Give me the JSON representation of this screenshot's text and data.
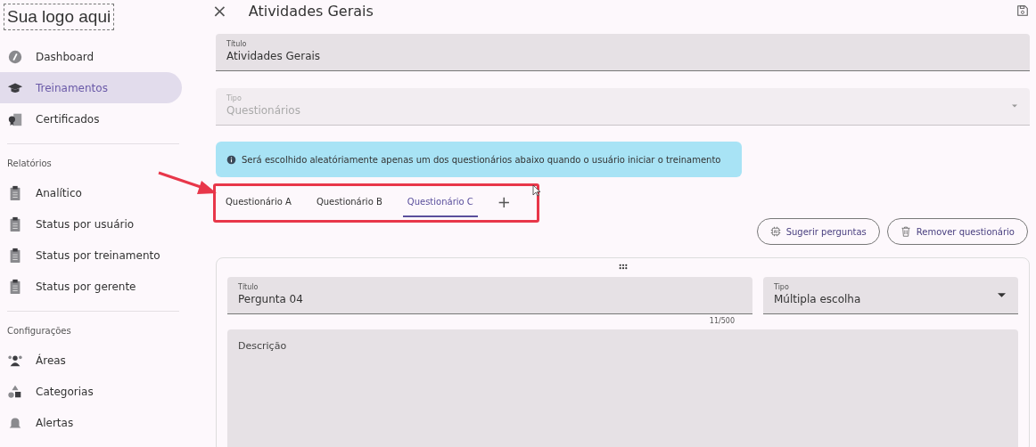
{
  "logo": "Sua logo aqui",
  "sidebar": {
    "items": [
      {
        "label": "Dashboard",
        "kind": "gauge",
        "selected": false
      },
      {
        "label": "Treinamentos",
        "kind": "cap",
        "selected": true
      },
      {
        "label": "Certificados",
        "kind": "certificate",
        "selected": false
      }
    ],
    "sections": [
      {
        "title": "Relatórios",
        "items": [
          {
            "label": "Analítico",
            "kind": "clipboard",
            "selected": false
          },
          {
            "label": "Status por usuário",
            "kind": "clipboard",
            "selected": false
          },
          {
            "label": "Status por treinamento",
            "kind": "clipboard",
            "selected": false
          },
          {
            "label": "Status por gerente",
            "kind": "clipboard",
            "selected": false
          }
        ]
      },
      {
        "title": "Configurações",
        "items": [
          {
            "label": "Áreas",
            "kind": "people",
            "selected": false
          },
          {
            "label": "Categorias",
            "kind": "shapes",
            "selected": false
          },
          {
            "label": "Alertas",
            "kind": "bell",
            "selected": false
          }
        ]
      }
    ]
  },
  "header": {
    "close": "×",
    "title": "Atividades Gerais"
  },
  "form": {
    "title_field": {
      "label": "Título",
      "value": "Atividades Gerais",
      "disabled": false
    },
    "type_field": {
      "label": "Tipo",
      "value": "Questionários",
      "disabled": true
    }
  },
  "info": "Será escolhido aleatóriamente apenas um dos questionários abaixo quando o usuário iniciar o treinamento",
  "tabs": [
    {
      "label": "Questionário A",
      "selected": false
    },
    {
      "label": "Questionário B",
      "selected": false
    },
    {
      "label": "Questionário C",
      "selected": true
    }
  ],
  "add_tab": "+",
  "actions": [
    {
      "label": "Sugerir perguntas",
      "kind": "suggest"
    },
    {
      "label": "Remover questionário",
      "kind": "remove"
    }
  ],
  "question": {
    "title_field": {
      "label": "Título",
      "value": "Pergunta 04",
      "counter": "11/500"
    },
    "type_field": {
      "label": "Tipo",
      "value": "Múltipla escolha"
    },
    "description": {
      "placeholder": "Descrição"
    }
  }
}
